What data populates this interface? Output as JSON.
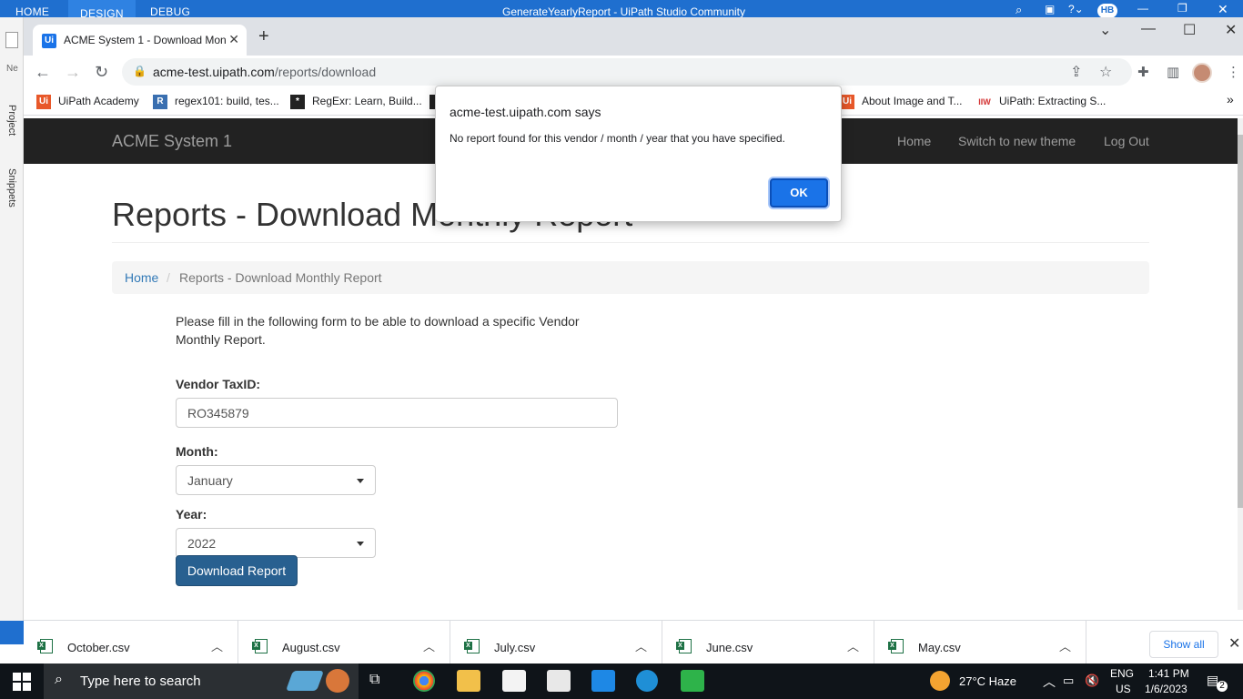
{
  "studio": {
    "tabs": [
      "HOME",
      "DESIGN",
      "DEBUG"
    ],
    "title": "GenerateYearlyReport - UiPath Studio Community",
    "user_initials": "HB",
    "panel_labels": [
      "Project",
      "Snippets"
    ],
    "new_label": "Ne"
  },
  "browser": {
    "tab_title": "ACME System 1 - Download Mon",
    "url_host": "acme-test.uipath.com",
    "url_path": "/reports/download",
    "bookmarks": [
      {
        "label": "UiPath Academy",
        "icon": "uipath-icon",
        "color": "#e8582a"
      },
      {
        "label": "regex101: build, tes...",
        "icon": "regex101-icon",
        "color": "#3a6fb0"
      },
      {
        "label": "RegExr: Learn, Build...",
        "icon": "regexr-icon",
        "color": "#222222"
      },
      {
        "label": "About Image and T...",
        "icon": "uipath-icon",
        "color": "#e8582a"
      },
      {
        "label": "UiPath: Extracting S...",
        "icon": "iiw-icon",
        "color": "#d32f2f"
      }
    ]
  },
  "acme": {
    "brand": "ACME System 1",
    "nav": [
      "Home",
      "Switch to new theme",
      "Log Out"
    ],
    "page_title": "Reports - Download Monthly Report",
    "breadcrumb": {
      "home": "Home",
      "separator": "/",
      "current": "Reports - Download Monthly Report"
    },
    "intro": "Please fill in the following form to be able to download a specific Vendor Monthly Report.",
    "vendor_label": "Vendor TaxID:",
    "vendor_value": "RO345879",
    "month_label": "Month:",
    "month_value": "January",
    "year_label": "Year:",
    "year_value": "2022",
    "download_label": "Download Report"
  },
  "dialog": {
    "origin": "acme-test.uipath.com says",
    "message": "No report found for this vendor / month / year that you have specified.",
    "ok_label": "OK"
  },
  "downloads": {
    "files": [
      "October.csv",
      "August.csv",
      "July.csv",
      "June.csv",
      "May.csv"
    ],
    "show_all": "Show all"
  },
  "taskbar": {
    "search_placeholder": "Type here to search",
    "weather": "27°C  Haze",
    "lang_top": "ENG",
    "lang_bottom": "US",
    "time": "1:41 PM",
    "date": "1/6/2023",
    "notifications": "2"
  },
  "colors": {
    "studio_blue": "#1f6fcf",
    "navbar": "#222222",
    "primary_button": "#286090",
    "link": "#337ab7",
    "dialog_ok": "#1a73e8"
  }
}
